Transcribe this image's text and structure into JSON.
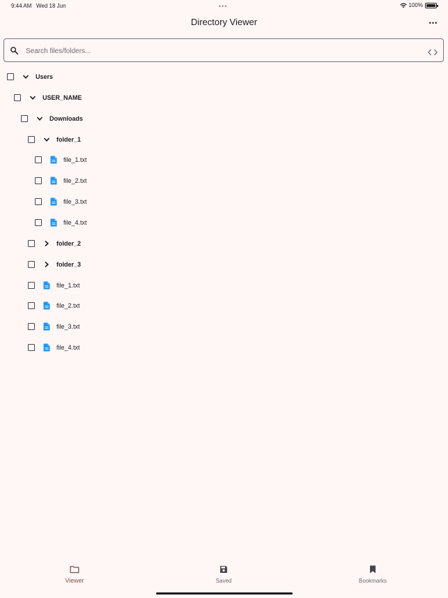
{
  "status_bar": {
    "time": "9:44 AM",
    "date": "Wed 18 Jun",
    "battery": "100%",
    "dots": "•••"
  },
  "app_bar": {
    "title": "Directory Viewer",
    "more_icon": "more-horizontal-icon",
    "more_glyph": "•••"
  },
  "search": {
    "placeholder": "Search files/folders...",
    "value": ""
  },
  "colors": {
    "background": "#fff7f6",
    "file_icon": "#2196f3",
    "accent": "#7d524b"
  },
  "tree": [
    {
      "label": "Users",
      "type": "folder",
      "depth": 0,
      "expanded": true
    },
    {
      "label": "USER_NAME",
      "type": "folder",
      "depth": 1,
      "expanded": true
    },
    {
      "label": "Downloads",
      "type": "folder",
      "depth": 2,
      "expanded": true
    },
    {
      "label": "folder_1",
      "type": "folder",
      "depth": 3,
      "expanded": true
    },
    {
      "label": "file_1.txt",
      "type": "file",
      "depth": 4
    },
    {
      "label": "file_2.txt",
      "type": "file",
      "depth": 4
    },
    {
      "label": "file_3.txt",
      "type": "file",
      "depth": 4
    },
    {
      "label": "file_4.txt",
      "type": "file",
      "depth": 4
    },
    {
      "label": "folder_2",
      "type": "folder",
      "depth": 3,
      "expanded": false
    },
    {
      "label": "folder_3",
      "type": "folder",
      "depth": 3,
      "expanded": false
    },
    {
      "label": "file_1.txt",
      "type": "file",
      "depth": 3
    },
    {
      "label": "file_2.txt",
      "type": "file",
      "depth": 3
    },
    {
      "label": "file_3.txt",
      "type": "file",
      "depth": 3
    },
    {
      "label": "file_4.txt",
      "type": "file",
      "depth": 3
    }
  ],
  "bottom_nav": {
    "items": [
      {
        "label": "Viewer",
        "icon": "folder-icon",
        "active": true
      },
      {
        "label": "Saved",
        "icon": "save-icon",
        "active": false
      },
      {
        "label": "Bookmarks",
        "icon": "bookmark-icon",
        "active": false
      }
    ]
  }
}
